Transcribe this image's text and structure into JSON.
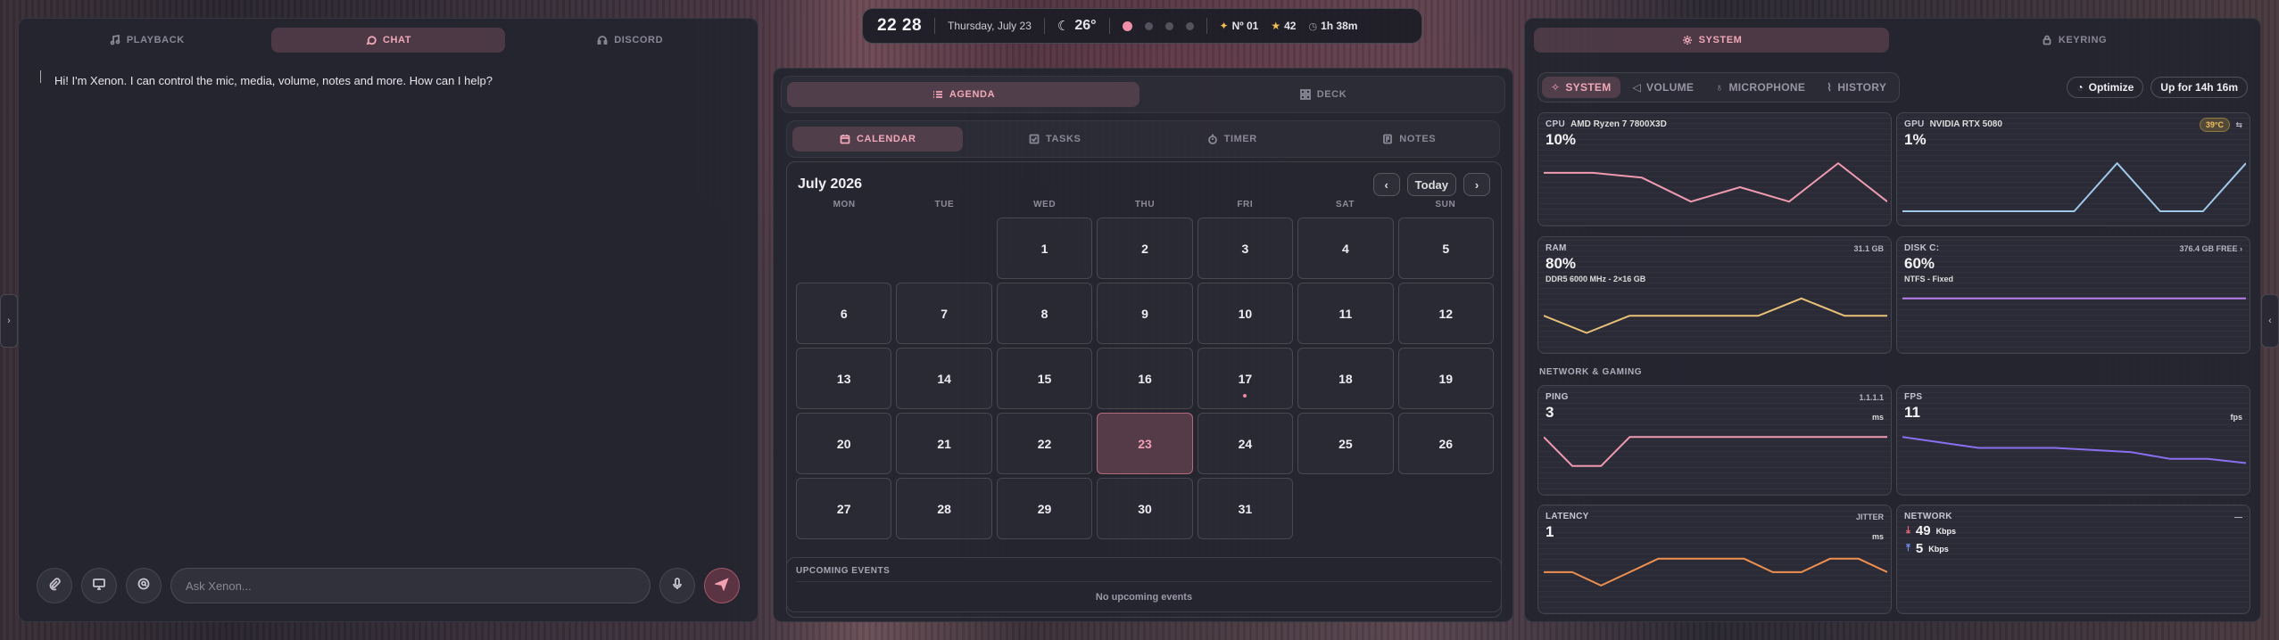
{
  "chat": {
    "tabs": [
      {
        "label": "PLAYBACK",
        "icon": "music-icon"
      },
      {
        "label": "CHAT",
        "icon": "chat-icon"
      },
      {
        "label": "DISCORD",
        "icon": "headphones-icon"
      }
    ],
    "message": "Hi! I'm Xenon. I can control the mic, media, volume, notes and more. How can I help?",
    "input_placeholder": "Ask Xenon..."
  },
  "statusbar": {
    "time": "22 28",
    "date": "Thursday, July 23",
    "temperature": "26°",
    "rank": "Nº 01",
    "stars": "42",
    "uptime": "1h 38m",
    "active_dot": 0,
    "dot_count": 4
  },
  "agenda": {
    "tabs": [
      {
        "label": "AGENDA",
        "icon": "list-icon"
      },
      {
        "label": "DECK",
        "icon": "grid-icon"
      }
    ],
    "subtabs": [
      {
        "label": "CALENDAR",
        "icon": "calendar-icon"
      },
      {
        "label": "TASKS",
        "icon": "check-icon"
      },
      {
        "label": "TIMER",
        "icon": "timer-icon"
      },
      {
        "label": "NOTES",
        "icon": "note-icon"
      }
    ],
    "calendar": {
      "month": "July 2026",
      "today_label": "Today",
      "weekdays": [
        "MON",
        "TUE",
        "WED",
        "THU",
        "FRI",
        "SAT",
        "SUN"
      ],
      "first_weekday_offset": 2,
      "days_in_month": 31,
      "today": 23,
      "event_days": [
        17
      ]
    },
    "upcoming": {
      "title": "UPCOMING EVENTS",
      "empty": "No upcoming events"
    }
  },
  "system": {
    "tabs": [
      {
        "label": "SYSTEM",
        "icon": "gear-icon"
      },
      {
        "label": "KEYRING",
        "icon": "lock-icon"
      }
    ],
    "subtabs": [
      {
        "label": "SYSTEM",
        "icon": "sparkle-icon"
      },
      {
        "label": "VOLUME",
        "icon": "volume-icon"
      },
      {
        "label": "MICROPHONE",
        "icon": "mic-icon"
      },
      {
        "label": "HISTORY",
        "icon": "chart-icon"
      }
    ],
    "optimize_label": "Optimize",
    "uptime_label": "Up for 14h 16m",
    "section_network": "NETWORK & GAMING",
    "cpu": {
      "label": "CPU",
      "name": "AMD Ryzen 7 7800X3D",
      "value": "10%",
      "color": "#f09ab0",
      "series": [
        4,
        4,
        3.5,
        1,
        2.5,
        1,
        5,
        1
      ]
    },
    "gpu": {
      "label": "GPU",
      "name": "NVIDIA RTX 5080",
      "value": "1%",
      "temp": "39°C",
      "color": "#a0c8e8",
      "series": [
        0,
        0,
        0,
        0,
        0,
        3,
        0,
        0,
        3
      ]
    },
    "ram": {
      "label": "RAM",
      "value": "80%",
      "total": "31.1 GB",
      "detail": "DDR5 6000 MHz - 2×16 GB",
      "color": "#e8c078",
      "series": [
        2,
        0.5,
        2,
        2,
        2,
        2,
        3.5,
        2,
        2
      ]
    },
    "disk": {
      "label": "DISK C:",
      "value": "60%",
      "free": "376.4 GB FREE",
      "detail": "NTFS - Fixed",
      "color": "#b87ef0",
      "series": [
        1,
        1,
        1,
        1,
        1,
        1,
        1,
        1,
        1
      ]
    },
    "ping": {
      "label": "PING",
      "value": "3",
      "unit": "ms",
      "target": "1.1.1.1",
      "color": "#f09ab0",
      "series": [
        3,
        1,
        1,
        3,
        3,
        3,
        3,
        3,
        3,
        3,
        3,
        3,
        3
      ]
    },
    "fps": {
      "label": "FPS",
      "value": "11",
      "unit": "fps",
      "color": "#8a70f0",
      "series": [
        4,
        3.5,
        3,
        3,
        3,
        2.8,
        2.6,
        2,
        2,
        1.6
      ]
    },
    "latency": {
      "label": "LATENCY",
      "value": "1",
      "unit": "ms",
      "extra": "JITTER",
      "color": "#f09050",
      "series": [
        2,
        2,
        1,
        2,
        3,
        3,
        3,
        3,
        2,
        2,
        3,
        3,
        2
      ]
    },
    "network": {
      "label": "NETWORK",
      "more": "—",
      "down": "49",
      "down_unit": "Kbps",
      "up": "5",
      "up_unit": "Kbps",
      "down_color": "#f06878",
      "up_color": "#7090f0"
    }
  }
}
